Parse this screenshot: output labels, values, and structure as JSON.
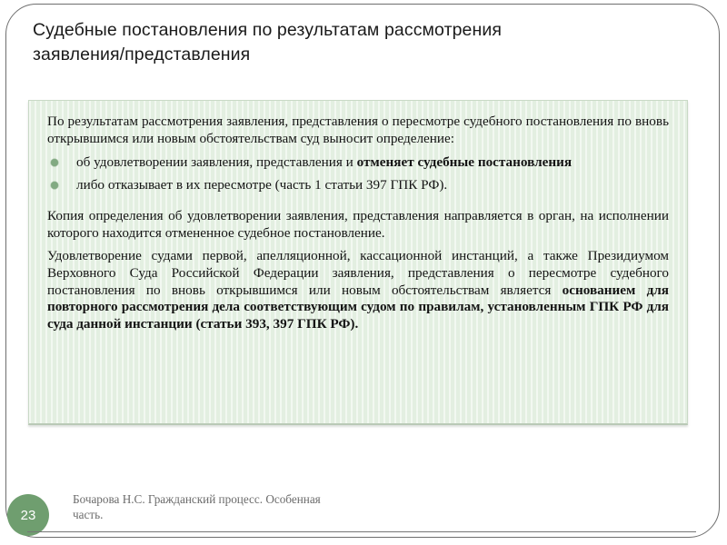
{
  "slide": {
    "title_line1": "Судебные постановления по результатам рассмотрения",
    "title_line2": "заявления/представления"
  },
  "content": {
    "intro_paragraph": "По результатам рассмотрения заявления, представления о пересмотре судебного постановления по вновь открывшимся или новым обстоятельствам суд выносит определение:",
    "bullets": [
      {
        "text_plain": " об удовлетворении заявления, представления и ",
        "text_bold": "отменяет судебные постановления"
      },
      {
        "text_plain": "либо отказывает в их пересмотре (часть 1 статьи 397 ГПК РФ).",
        "text_bold": ""
      }
    ],
    "paragraph_copy": "Копия определения об удовлетворении заявления, представления направляется в орган, на исполнении которого находится отмененное судебное постановление.",
    "paragraph_final_lead": "Удовлетворение судами первой, апелляционной, кассационной инстанций, а также Президиумом Верховного Суда Российской Федерации заявления, представления о пересмотре судебного постановления по вновь открывшимся или новым обстоятельствам является ",
    "paragraph_final_bold": "основанием для повторного рассмотрения дела соответствующим судом по правилам, установленным ГПК РФ для суда данной инстанции (статьи 393, 397 ГПК РФ)."
  },
  "footer": {
    "page_number": "23",
    "source_line1": "Бочарова Н.С. Гражданский процесс. Особенная",
    "source_line2": "часть."
  },
  "colors": {
    "box_background": "#e3efe1",
    "badge_green": "#6f9e6f",
    "bullet_green": "#82aa82",
    "frame_border": "#6e6e6e",
    "footer_text": "#6b6b6b"
  }
}
